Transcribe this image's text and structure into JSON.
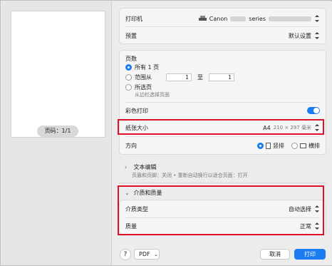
{
  "preview": {
    "page_indicator": "页码：1/1"
  },
  "printer": {
    "label": "打印机",
    "value_prefix": "Canon",
    "value_suffix": "series"
  },
  "presets": {
    "label": "预置",
    "value": "默认设置"
  },
  "pages": {
    "title": "页数",
    "all_label": "所有 1 页",
    "range_label": "范围从",
    "range_from": "1",
    "range_to_label": "至",
    "range_to": "1",
    "selection_label": "所选页",
    "selection_sub": "从边栏选择页面"
  },
  "color": {
    "label": "彩色打印",
    "on": true
  },
  "paper_size": {
    "label": "纸张大小",
    "size": "A4",
    "dims": "210 × 297 毫米"
  },
  "orientation": {
    "label": "方向",
    "portrait": "竖排",
    "landscape": "横排"
  },
  "text_edit": {
    "label": "文本编辑",
    "sub": "页眉和页脚：关闭 • 重新自动换行以适合页面：打开"
  },
  "media_quality": {
    "label": "介质和质量",
    "media_type_label": "介质类型",
    "media_type_value": "自动选择",
    "quality_label": "质量",
    "quality_value": "正常"
  },
  "footer": {
    "help": "?",
    "pdf": "PDF",
    "cancel": "取消",
    "print": "打印"
  },
  "colors": {
    "accent": "#1b7bf0",
    "highlight": "#e0102a"
  }
}
